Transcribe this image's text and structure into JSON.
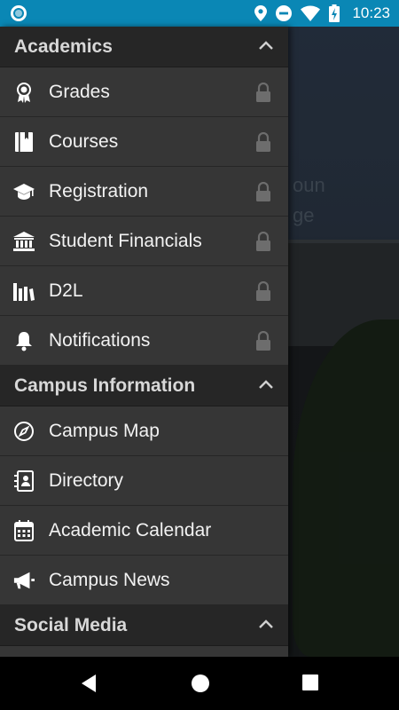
{
  "status_bar": {
    "time": "10:23",
    "icons": [
      "app-notification-icon",
      "location-icon",
      "do-not-disturb-icon",
      "wifi-icon",
      "battery-charging-icon"
    ]
  },
  "background": {
    "text_line1": "oun",
    "text_line2": "ge"
  },
  "drawer": {
    "sections": [
      {
        "title": "Academics",
        "items": [
          {
            "label": "Grades",
            "icon": "award-icon",
            "locked": true
          },
          {
            "label": "Courses",
            "icon": "book-icon",
            "locked": true
          },
          {
            "label": "Registration",
            "icon": "graduation-cap-icon",
            "locked": true
          },
          {
            "label": "Student Financials",
            "icon": "bank-icon",
            "locked": true
          },
          {
            "label": "D2L",
            "icon": "books-icon",
            "locked": true
          },
          {
            "label": "Notifications",
            "icon": "bell-icon",
            "locked": true
          }
        ]
      },
      {
        "title": "Campus Information",
        "items": [
          {
            "label": "Campus Map",
            "icon": "compass-icon",
            "locked": false
          },
          {
            "label": "Directory",
            "icon": "contact-book-icon",
            "locked": false
          },
          {
            "label": "Academic Calendar",
            "icon": "calendar-icon",
            "locked": false
          },
          {
            "label": "Campus News",
            "icon": "megaphone-icon",
            "locked": false
          }
        ]
      },
      {
        "title": "Social Media",
        "items": []
      }
    ]
  },
  "nav_bar": {
    "buttons": [
      "back-icon",
      "home-icon",
      "recents-icon"
    ]
  },
  "colors": {
    "status_bar": "#0a87b5",
    "drawer": "#363636",
    "section_header": "#262626"
  }
}
